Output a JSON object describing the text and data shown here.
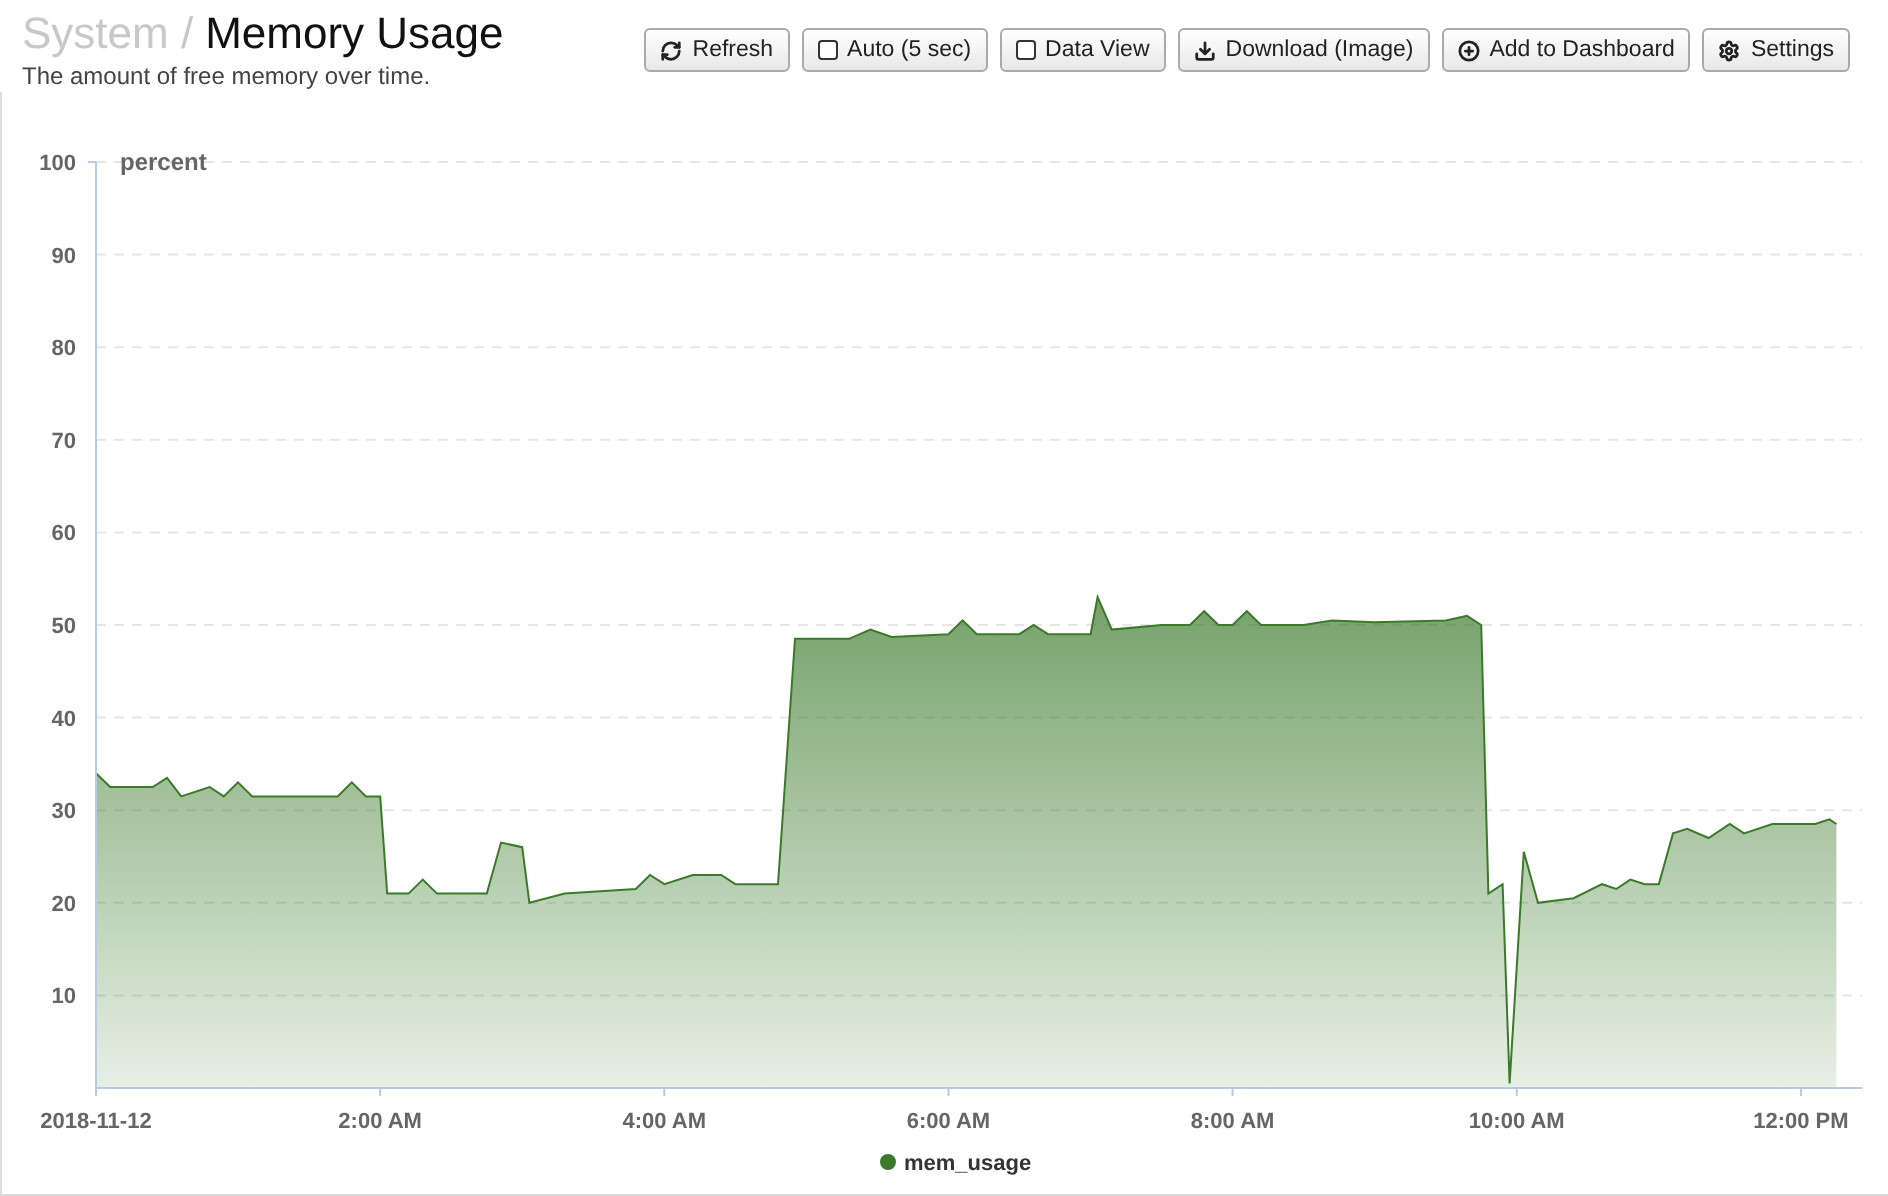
{
  "header": {
    "parent": "System /",
    "title": "Memory Usage",
    "subtitle": "The amount of free memory over time."
  },
  "toolbar": [
    {
      "kind": "refresh",
      "label": "Refresh"
    },
    {
      "kind": "checkbox",
      "checked": false,
      "label": "Auto (5 sec)"
    },
    {
      "kind": "checkbox",
      "checked": false,
      "label": "Data View"
    },
    {
      "kind": "download",
      "label": "Download (Image)"
    },
    {
      "kind": "add",
      "label": "Add to Dashboard"
    },
    {
      "kind": "settings",
      "label": "Settings"
    }
  ],
  "chart": {
    "chart_data": {
      "type": "area",
      "ylabel": "percent",
      "xlim": [
        0,
        12.43
      ],
      "ylim": [
        0,
        100
      ],
      "grid": true,
      "yticks": [
        10,
        20,
        30,
        40,
        50,
        60,
        70,
        80,
        90,
        100
      ],
      "xticks": [
        {
          "value": 0,
          "label": "2018-11-12"
        },
        {
          "value": 2,
          "label": "2:00 AM"
        },
        {
          "value": 4,
          "label": "4:00 AM"
        },
        {
          "value": 6,
          "label": "6:00 AM"
        },
        {
          "value": 8,
          "label": "8:00 AM"
        },
        {
          "value": 10,
          "label": "10:00 AM"
        },
        {
          "value": 12,
          "label": "12:00 PM"
        }
      ],
      "x": [
        0,
        0.1,
        0.4,
        0.5,
        0.6,
        0.8,
        0.9,
        1.0,
        1.1,
        1.7,
        1.8,
        1.9,
        2.0,
        2.05,
        2.2,
        2.3,
        2.4,
        2.75,
        2.85,
        3.0,
        3.05,
        3.3,
        3.8,
        3.9,
        4.0,
        4.2,
        4.4,
        4.5,
        4.8,
        4.92,
        5.3,
        5.45,
        5.6,
        6.0,
        6.1,
        6.2,
        6.5,
        6.6,
        6.7,
        7.0,
        7.05,
        7.15,
        7.5,
        7.7,
        7.8,
        7.9,
        8.0,
        8.1,
        8.2,
        8.5,
        8.7,
        9.0,
        9.5,
        9.65,
        9.75,
        9.8,
        9.9,
        9.95,
        10.05,
        10.15,
        10.4,
        10.6,
        10.7,
        10.8,
        10.9,
        11.0,
        11.1,
        11.2,
        11.35,
        11.5,
        11.6,
        11.8,
        12.1,
        12.2,
        12.25
      ],
      "series": [
        {
          "name": "mem_usage",
          "color": "#3b7a2a",
          "values": [
            34,
            32.5,
            32.5,
            33.5,
            31.5,
            32.5,
            31.5,
            33,
            31.5,
            31.5,
            33,
            31.5,
            31.5,
            21,
            21,
            22.5,
            21,
            21,
            26.5,
            26,
            20,
            21,
            21.5,
            23,
            22,
            23,
            23,
            22,
            22,
            48.5,
            48.5,
            49.5,
            48.7,
            49,
            50.5,
            49,
            49,
            50,
            49,
            49,
            53,
            49.5,
            50,
            50,
            51.5,
            50,
            50,
            51.5,
            50,
            50,
            50.5,
            50.3,
            50.5,
            51,
            50,
            21,
            22,
            0.5,
            25.5,
            20,
            20.5,
            22,
            21.5,
            22.5,
            22,
            22,
            27.5,
            28,
            27,
            28.5,
            27.5,
            28.5,
            28.5,
            29,
            28.5
          ]
        }
      ]
    }
  }
}
